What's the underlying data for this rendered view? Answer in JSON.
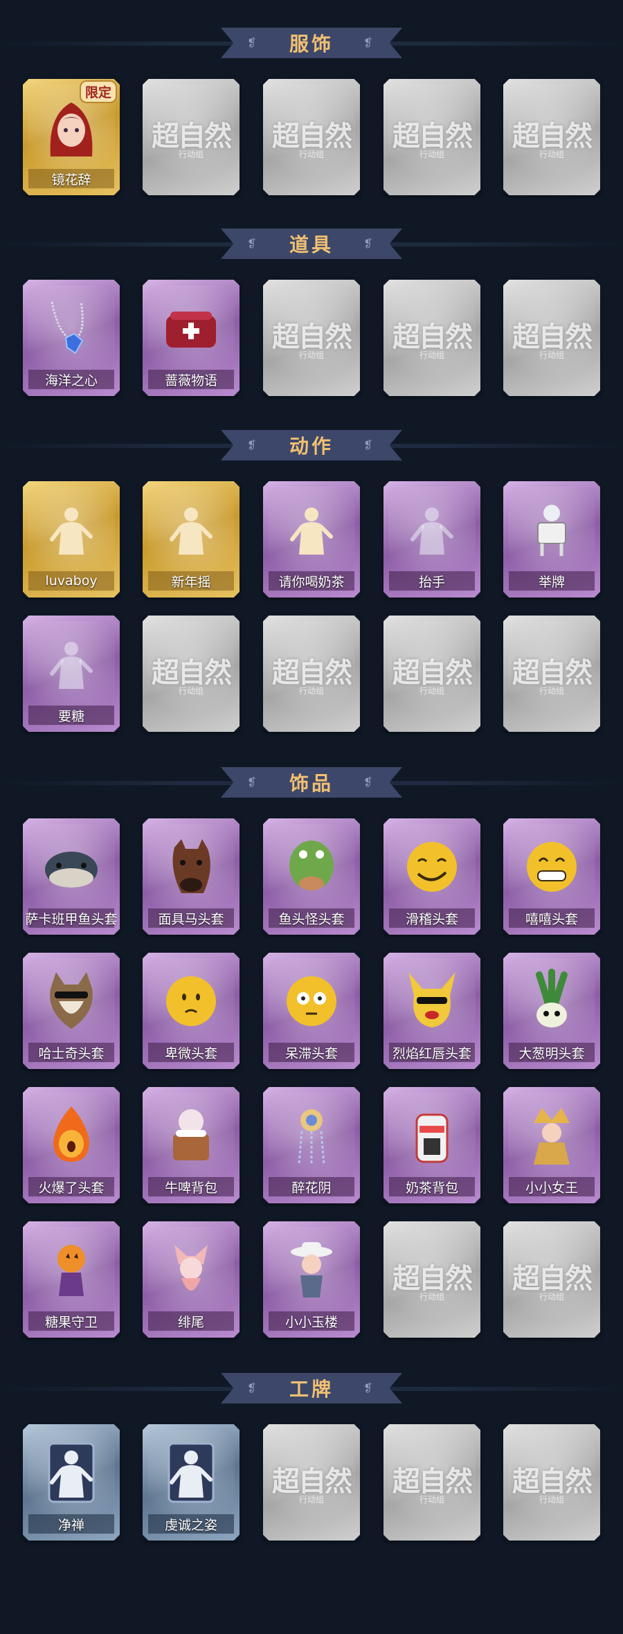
{
  "colors": {
    "background": "#101826",
    "banner": "#3d4769",
    "banner_text": "#f1c072"
  },
  "sections": [
    {
      "title": "服饰",
      "cards": [
        {
          "label": "镜花辞",
          "tier": "gold",
          "badge": "限定",
          "icon": "red-hood-girl-portrait"
        },
        {
          "placeholder": "超自然",
          "placeholder_sub": "行动组",
          "tier": "gray"
        },
        {
          "placeholder": "超自然",
          "placeholder_sub": "行动组",
          "tier": "gray"
        },
        {
          "placeholder": "超自然",
          "placeholder_sub": "行动组",
          "tier": "gray"
        },
        {
          "placeholder": "超自然",
          "placeholder_sub": "行动组",
          "tier": "gray"
        }
      ]
    },
    {
      "title": "道具",
      "cards": [
        {
          "label": "海洋之心",
          "tier": "purple",
          "icon": "blue-gem-necklace"
        },
        {
          "label": "蔷薇物语",
          "tier": "purple",
          "icon": "red-medical-box"
        },
        {
          "placeholder": "超自然",
          "placeholder_sub": "行动组",
          "tier": "gray"
        },
        {
          "placeholder": "超自然",
          "placeholder_sub": "行动组",
          "tier": "gray"
        },
        {
          "placeholder": "超自然",
          "placeholder_sub": "行动组",
          "tier": "gray"
        }
      ]
    },
    {
      "title": "动作",
      "cards": [
        {
          "label": "luvaboy",
          "tier": "gold",
          "icon": "pose-silhouette"
        },
        {
          "label": "新年摇",
          "tier": "gold",
          "icon": "pose-silhouette"
        },
        {
          "label": "请你喝奶茶",
          "tier": "purple",
          "icon": "pose-silhouette"
        },
        {
          "label": "抬手",
          "tier": "purple",
          "icon": "pose-silhouette-faded"
        },
        {
          "label": "举牌",
          "tier": "purple",
          "icon": "sign-holder"
        },
        {
          "label": "要糖",
          "tier": "purple",
          "icon": "pose-silhouette-faded"
        },
        {
          "placeholder": "超自然",
          "placeholder_sub": "行动组",
          "tier": "gray"
        },
        {
          "placeholder": "超自然",
          "placeholder_sub": "行动组",
          "tier": "gray"
        },
        {
          "placeholder": "超自然",
          "placeholder_sub": "行动组",
          "tier": "gray"
        },
        {
          "placeholder": "超自然",
          "placeholder_sub": "行动组",
          "tier": "gray"
        }
      ]
    },
    {
      "title": "饰品",
      "cards": [
        {
          "label": "萨卡班甲鱼头套",
          "tier": "purple",
          "icon": "fish-head-mask"
        },
        {
          "label": "面具马头套",
          "tier": "purple",
          "icon": "horse-head-mask"
        },
        {
          "label": "鱼头怪头套",
          "tier": "purple",
          "icon": "green-fish-mask"
        },
        {
          "label": "滑稽头套",
          "tier": "purple",
          "icon": "smirk-face-mask"
        },
        {
          "label": "嘻嘻头套",
          "tier": "purple",
          "icon": "grin-face-mask"
        },
        {
          "label": "哈士奇头套",
          "tier": "purple",
          "icon": "husky-mask"
        },
        {
          "label": "卑微头套",
          "tier": "purple",
          "icon": "humble-face-mask"
        },
        {
          "label": "呆滞头套",
          "tier": "purple",
          "icon": "dazed-face-mask"
        },
        {
          "label": "烈焰红唇头套",
          "tier": "purple",
          "icon": "pikachu-mask"
        },
        {
          "label": "大葱明头套",
          "tier": "purple",
          "icon": "leek-mask"
        },
        {
          "label": "火爆了头套",
          "tier": "purple",
          "icon": "fire-mask"
        },
        {
          "label": "牛啤背包",
          "tier": "purple",
          "icon": "cow-beer-backpack"
        },
        {
          "label": "醉花阴",
          "tier": "purple",
          "icon": "flower-ornament"
        },
        {
          "label": "奶茶背包",
          "tier": "purple",
          "icon": "milk-tea-backpack"
        },
        {
          "label": "小小女王",
          "tier": "purple",
          "icon": "little-queen"
        },
        {
          "label": "糖果守卫",
          "tier": "purple",
          "icon": "pumpkin-doll"
        },
        {
          "label": "绯尾",
          "tier": "purple",
          "icon": "fox-charm"
        },
        {
          "label": "小小玉楼",
          "tier": "purple",
          "icon": "hat-doll"
        },
        {
          "placeholder": "超自然",
          "placeholder_sub": "行动组",
          "tier": "gray"
        },
        {
          "placeholder": "超自然",
          "placeholder_sub": "行动组",
          "tier": "gray"
        }
      ]
    },
    {
      "title": "工牌",
      "cards": [
        {
          "label": "净禅",
          "tier": "blue",
          "icon": "id-card-silhouette"
        },
        {
          "label": "虔诚之姿",
          "tier": "blue",
          "icon": "id-card-silhouette"
        },
        {
          "placeholder": "超自然",
          "placeholder_sub": "行动组",
          "tier": "gray"
        },
        {
          "placeholder": "超自然",
          "placeholder_sub": "行动组",
          "tier": "gray"
        },
        {
          "placeholder": "超自然",
          "placeholder_sub": "行动组",
          "tier": "gray"
        }
      ]
    }
  ]
}
